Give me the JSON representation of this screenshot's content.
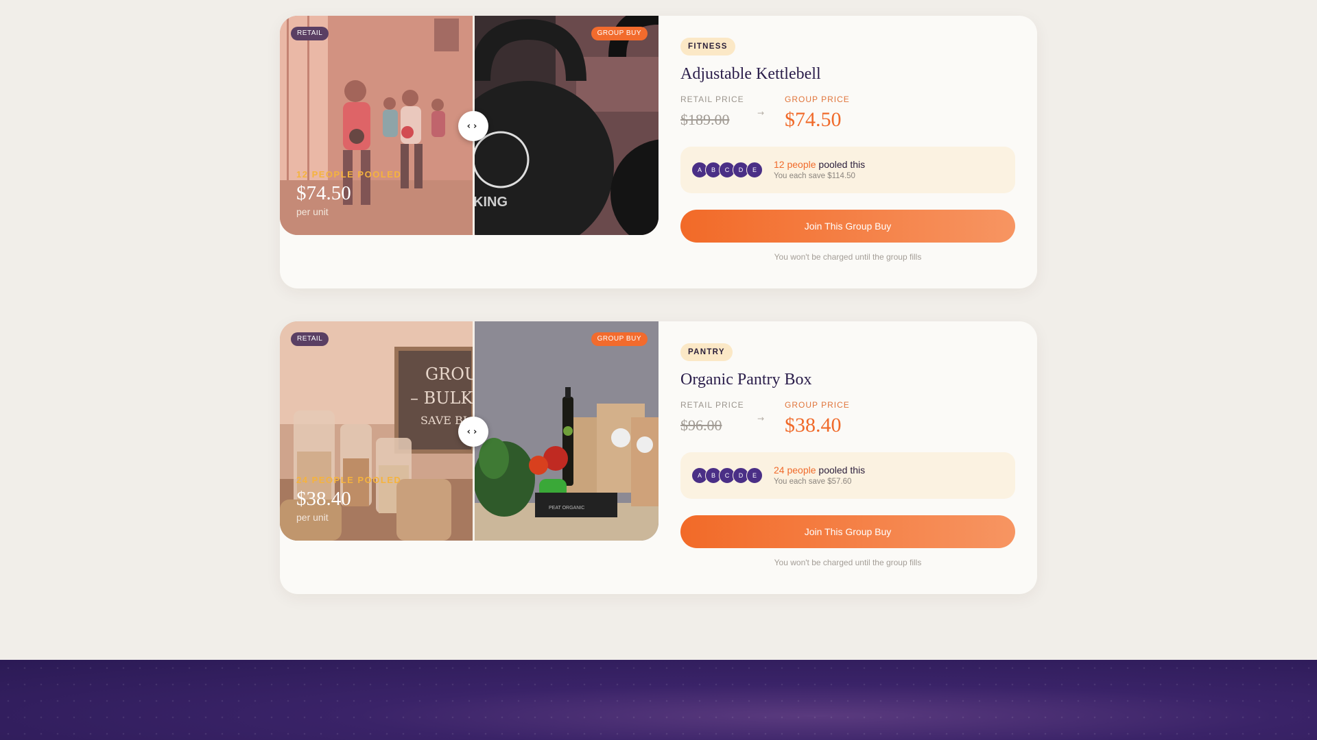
{
  "colors": {
    "accent": "#f26b2d",
    "brand_purple": "#3a2368",
    "retail_tag": "#5a3f63",
    "category_badge": "#fbe8c6"
  },
  "products": [
    {
      "retail_tag": "RETAIL",
      "group_tag": "GROUP BUY",
      "overlay_pooled": "12 PEOPLE POOLED",
      "overlay_price": "$74.50",
      "overlay_unit": "per unit",
      "category": "FITNESS",
      "name": "Adjustable Kettlebell",
      "retail_label": "RETAIL PRICE",
      "retail_price": "$189.00",
      "group_label": "GROUP PRICE",
      "group_price": "$74.50",
      "avatars": [
        "A",
        "B",
        "C",
        "D",
        "E"
      ],
      "pool_count": "12 people",
      "pool_suffix": "pooled this",
      "savings": "You each save $114.50",
      "cta": "Join This Group Buy",
      "note": "You won't be charged until the group fills",
      "left_image": "fitness-class-photo",
      "right_image": "kettlebell-closeup-photo"
    },
    {
      "retail_tag": "RETAIL",
      "group_tag": "GROUP BUY",
      "overlay_pooled": "24 PEOPLE POOLED",
      "overlay_price": "$38.40",
      "overlay_unit": "per unit",
      "category": "PANTRY",
      "name": "Organic Pantry Box",
      "retail_label": "RETAIL PRICE",
      "retail_price": "$96.00",
      "group_label": "GROUP PRICE",
      "group_price": "$38.40",
      "avatars": [
        "A",
        "B",
        "C",
        "D",
        "E"
      ],
      "pool_count": "24 people",
      "pool_suffix": "pooled this",
      "savings": "You each save $57.60",
      "cta": "Join This Group Buy",
      "note": "You won't be charged until the group fills",
      "left_image": "bulk-pantry-jars-photo",
      "right_image": "organic-groceries-photo"
    }
  ],
  "icons": {
    "compare_handle": "chevron-left-right-icon",
    "price_arrow": "arrow-right-icon"
  }
}
